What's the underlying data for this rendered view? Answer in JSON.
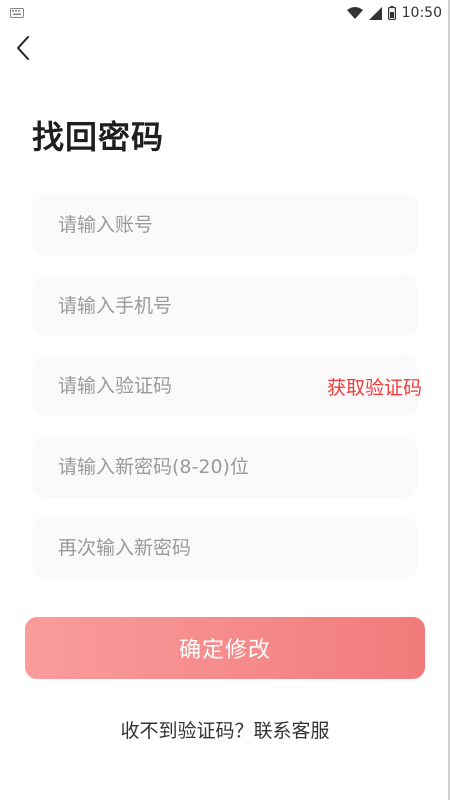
{
  "status_bar": {
    "time": "10:50",
    "icons": [
      "keyboard-icon",
      "wifi-icon",
      "signal-icon",
      "battery-icon"
    ]
  },
  "header": {
    "back_icon": "chevron-left-icon",
    "title": "找回密码"
  },
  "form": {
    "account": {
      "placeholder": "请输入账号",
      "value": ""
    },
    "phone": {
      "placeholder": "请输入手机号",
      "value": ""
    },
    "code": {
      "placeholder": "请输入验证码",
      "value": "",
      "get_code_label": "获取验证码"
    },
    "new_password": {
      "placeholder": "请输入新密码(8-20)位",
      "value": ""
    },
    "confirm_password": {
      "placeholder": "再次输入新密码",
      "value": ""
    }
  },
  "submit": {
    "label": "确定修改"
  },
  "help": {
    "label": "收不到验证码？联系客服"
  },
  "colors": {
    "accent_red": "#f03c3c",
    "button_gradient_start": "#fa9c9c",
    "button_gradient_end": "#f27b7b",
    "field_background": "#fbf9fa"
  }
}
